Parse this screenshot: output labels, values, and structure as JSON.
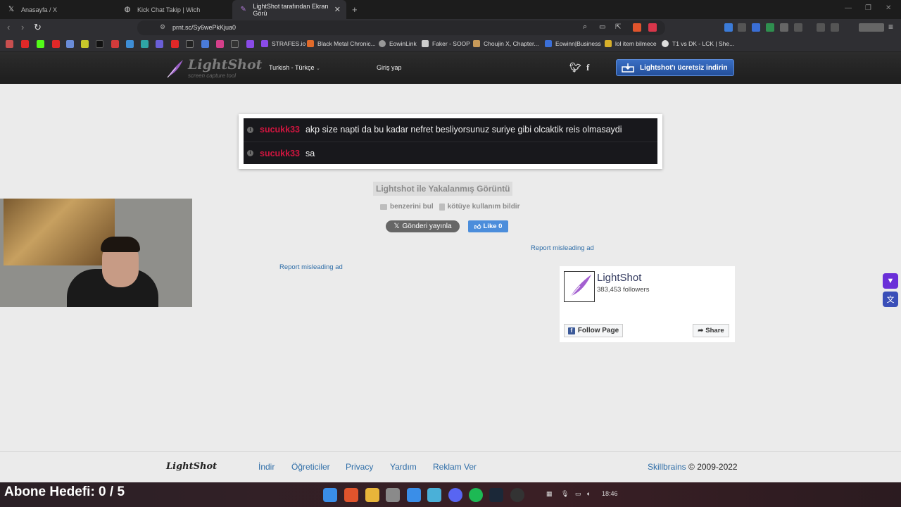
{
  "browser": {
    "tabs": [
      {
        "title": "Anasayfa / X",
        "icon": "x-logo-icon"
      },
      {
        "title": "Kick Chat Takip | Wich",
        "icon": "globe-icon"
      },
      {
        "title": "LightShot tarafından Ekran Görü",
        "icon": "feather-icon",
        "active": true
      }
    ],
    "url": "prnt.sc/Sy6wePkKjua0",
    "bookmarks": [
      "STRAFES.io",
      "Black Metal Chronic...",
      "EowinLink",
      "Faker - SOOP",
      "Choujin X, Chapter...",
      "Eowinn|Business",
      "lol item bilmece",
      "T1 vs DK - LCK | She..."
    ]
  },
  "lightshot": {
    "logo_name": "LightShot",
    "logo_tagline": "screen capture tool",
    "language": "Turkish - Türkçe",
    "login": "Giriş yap",
    "download_button": "Lightshot'ı ücretsiz indirin",
    "screenshot_chat": [
      {
        "user": "sucukk33",
        "message": "akp size napti da bu kadar nefret besliyorsunuz suriye gibi olcaktik reis olmasaydi"
      },
      {
        "user": "sucukk33",
        "message": "sa"
      }
    ],
    "capture_title": "Lightshot ile Yakalanmış Görüntü",
    "find_similar": "benzerini bul",
    "report_abuse": "kötüye kullanım bildir",
    "tweet_button": "Gönderi yayınla",
    "like_button": "Like 0",
    "report_ad_1": "Report misleading ad",
    "report_ad_2": "Report misleading ad",
    "fb_page": {
      "name": "LightShot",
      "followers": "383,453 followers",
      "follow_label": "Follow Page",
      "share_label": "Share"
    },
    "footer": {
      "logo": "LightShot",
      "links": [
        "İndir",
        "Öğreticiler",
        "Privacy",
        "Yardım",
        "Reklam Ver"
      ],
      "company": "Skillbrains",
      "copyright": "© 2009-2022"
    }
  },
  "overlay": {
    "goal_text": "Abone Hedefi:  0 / 5"
  },
  "taskbar": {
    "time": "18:46"
  },
  "colors": {
    "chat_user": "#d0153f",
    "download_button": "#2f5fb0",
    "link": "#2f6ea8"
  }
}
